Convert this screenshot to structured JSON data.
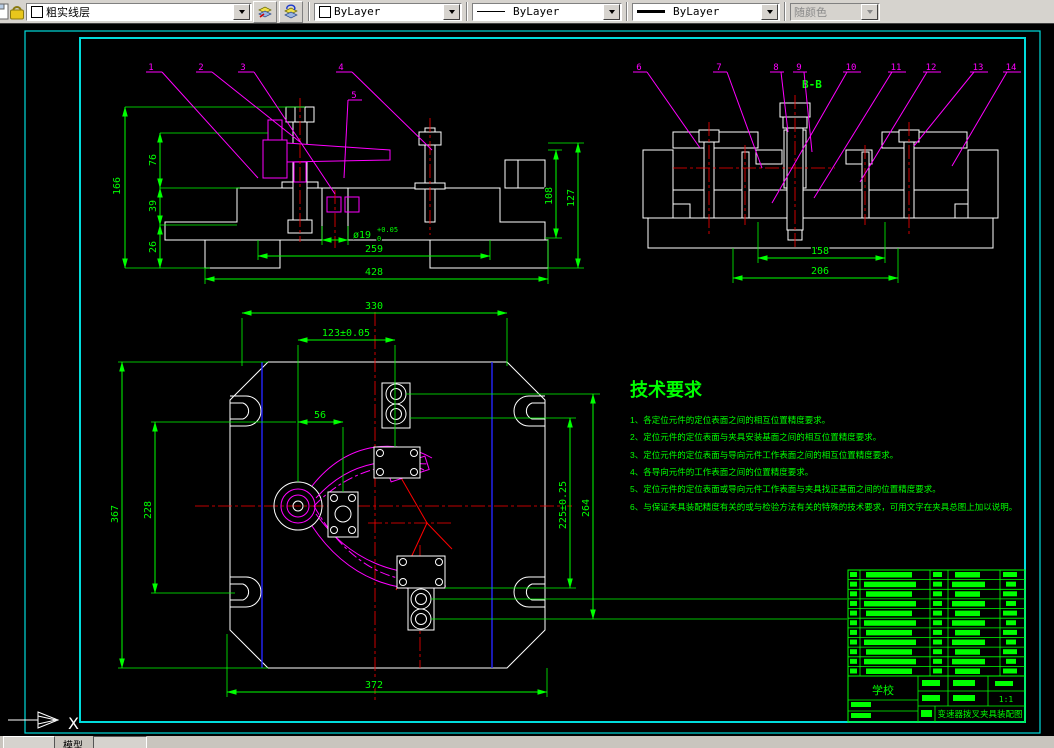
{
  "toolbar": {
    "layer_value": "粗实线层",
    "color_value": "ByLayer",
    "linetype_value": "ByLayer",
    "lineweight_value": "ByLayer",
    "plotstyle_value": "随颜色"
  },
  "statusbar": {
    "model_tab": "模型"
  },
  "ucs_label": "X",
  "view_labels": {
    "section": "B-B"
  },
  "dims": {
    "f166": "166",
    "f76": "76",
    "f39": "39",
    "f26": "26",
    "f108": "108",
    "f127": "127",
    "f259": "259",
    "f428": "428",
    "fdia": "ø19",
    "fdia_tol_up": "+0.05",
    "fdia_tol_dn": "0",
    "s158": "158",
    "s206": "206",
    "t330": "330",
    "t123": "123±0.05",
    "t56": "56",
    "t372": "372",
    "t367": "367",
    "t228": "228",
    "t225": "225±0.25",
    "t264": "264"
  },
  "balloons": {
    "front": [
      "1",
      "2",
      "3",
      "4",
      "5"
    ],
    "side": [
      "6",
      "7",
      "8",
      "9",
      "10",
      "11",
      "12",
      "13",
      "14"
    ]
  },
  "tech_req": {
    "title": "技术要求",
    "items": [
      "1、各定位元件的定位表面之间的相互位置精度要求。",
      "2、定位元件的定位表面与夹具安装基面之间的相互位置精度要求。",
      "3、定位元件的定位表面与导向元件工作表面之间的相互位置精度要求。",
      "4、各导向元件的工作表面之间的位置精度要求。",
      "5、定位元件的定位表面或导向元件工作表面与夹具找正基面之间的位置精度要求。",
      "6、与保证夹具装配精度有关的或与检验方法有关的特殊的技术要求，可用文字在夹具总图上加以说明。"
    ]
  },
  "titleblock": {
    "school": "学校",
    "scale": "1:1",
    "title": "变速器拨叉夹具装配图",
    "bom_rows": 11
  },
  "colors": {
    "dimension": "#00ff00",
    "object": "#ffffff",
    "hatch": "#00ffff",
    "centerline": "#ff0000",
    "leader": "#ff00ff",
    "aux": "#2626ff",
    "bushing": "#ffff00",
    "frame": "#00dcdc"
  }
}
